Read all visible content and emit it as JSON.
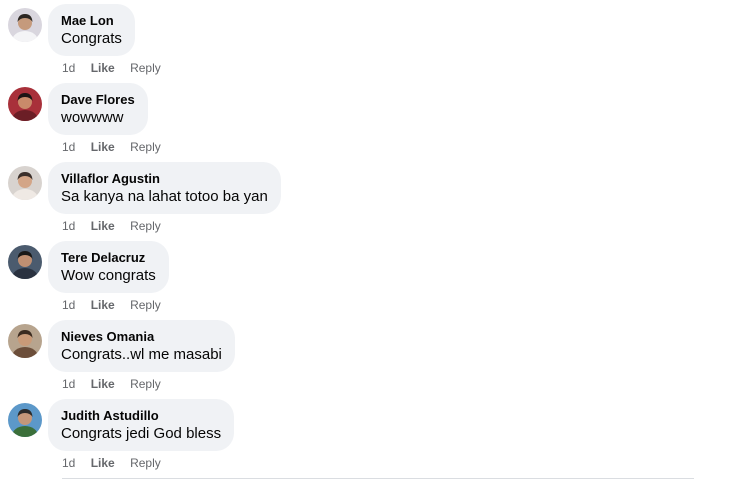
{
  "comments": [
    {
      "author": "Mae Lon",
      "text": "Congrats",
      "time": "1d",
      "like_label": "Like",
      "reply_label": "Reply",
      "avatar_colors": {
        "bg": "#d9d6de",
        "shirt": "#f4f4f6",
        "face": "#c59a7c",
        "hair": "#2b2622"
      }
    },
    {
      "author": "Dave Flores",
      "text": "wowwww",
      "time": "1d",
      "like_label": "Like",
      "reply_label": "Reply",
      "avatar_colors": {
        "bg": "#a8303a",
        "shirt": "#6b1e26",
        "face": "#c98a6a",
        "hair": "#1c1414"
      }
    },
    {
      "author": "Villaflor Agustin",
      "text": "Sa kanya na lahat totoo ba yan",
      "time": "1d",
      "like_label": "Like",
      "reply_label": "Reply",
      "avatar_colors": {
        "bg": "#d8d3cf",
        "shirt": "#efe9e4",
        "face": "#d3a587",
        "hair": "#3a2f2a"
      }
    },
    {
      "author": "Tere Delacruz",
      "text": "Wow congrats",
      "time": "1d",
      "like_label": "Like",
      "reply_label": "Reply",
      "avatar_colors": {
        "bg": "#4b5b6e",
        "shirt": "#2a3240",
        "face": "#bf8f72",
        "hair": "#181818"
      }
    },
    {
      "author": "Nieves Omania",
      "text": "Congrats..wl me masabi",
      "time": "1d",
      "like_label": "Like",
      "reply_label": "Reply",
      "avatar_colors": {
        "bg": "#b7a48e",
        "shirt": "#6c4e3a",
        "face": "#c99a78",
        "hair": "#3b2b20"
      }
    },
    {
      "author": "Judith Astudillo",
      "text": "Congrats jedi God bless",
      "time": "1d",
      "like_label": "Like",
      "reply_label": "Reply",
      "avatar_colors": {
        "bg": "#5c98c9",
        "shirt": "#3b6f3a",
        "face": "#c4977a",
        "hair": "#2a2a2a"
      }
    }
  ],
  "colors": {
    "bubble": "#f0f2f5",
    "meta_text": "#65676b",
    "primary_text": "#050505"
  }
}
